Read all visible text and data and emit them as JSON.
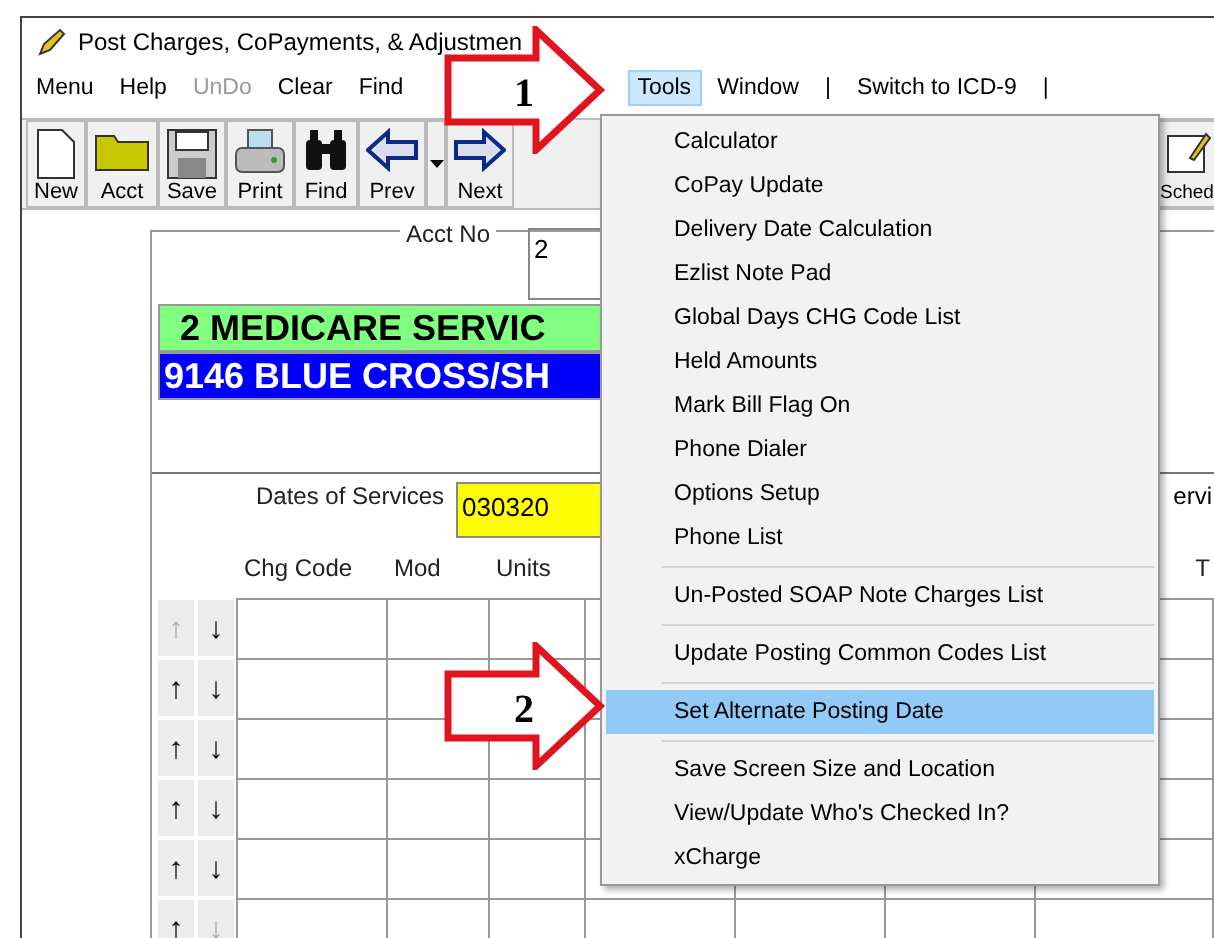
{
  "window": {
    "title": "Post Charges, CoPayments, & Adjustmen"
  },
  "menu_bar": [
    {
      "label": "Menu",
      "selected": false,
      "disabled": false
    },
    {
      "label": "Help",
      "selected": false,
      "disabled": false
    },
    {
      "label": "UnDo",
      "selected": false,
      "disabled": true
    },
    {
      "label": "Clear",
      "selected": false,
      "disabled": false
    },
    {
      "label": "Find",
      "selected": false,
      "disabled": false
    },
    {
      "label": "Tools",
      "selected": true,
      "disabled": false
    },
    {
      "label": "Window",
      "selected": false,
      "disabled": false
    },
    {
      "label": "|",
      "selected": false,
      "disabled": false
    },
    {
      "label": "Switch to ICD-9",
      "selected": false,
      "disabled": false
    },
    {
      "label": "|",
      "selected": false,
      "disabled": false
    }
  ],
  "toolbar": [
    {
      "label": "New",
      "kind": "new"
    },
    {
      "label": "Acct",
      "kind": "folder"
    },
    {
      "label": "Save",
      "kind": "save"
    },
    {
      "label": "Print",
      "kind": "print"
    },
    {
      "label": "Find",
      "kind": "find"
    },
    {
      "label": "Prev",
      "kind": "prev"
    },
    {
      "label": "Next",
      "kind": "next"
    }
  ],
  "toolbar_right": {
    "label": "Sched"
  },
  "form": {
    "acct_label": "Acct No",
    "acct_value": "2",
    "insurance": [
      {
        "text": "2 MEDICARE SERVIC",
        "color": "#80ff80"
      },
      {
        "text": "9146 BLUE CROSS/SH",
        "color": "#0000ff"
      }
    ],
    "dates_label": "Dates of Services",
    "dates_value": "030320",
    "right_label": "ervi",
    "columns": [
      "Chg Code",
      "Mod",
      "Units"
    ],
    "right_column": "T",
    "rows": [
      {
        "up": {
          "symbol": "↑",
          "disabled": true
        },
        "down": {
          "symbol": "↓",
          "disabled": false
        }
      },
      {
        "up": {
          "symbol": "↑",
          "disabled": false
        },
        "down": {
          "symbol": "↓",
          "disabled": false
        }
      },
      {
        "up": {
          "symbol": "↑",
          "disabled": false
        },
        "down": {
          "symbol": "↓",
          "disabled": false
        }
      },
      {
        "up": {
          "symbol": "↑",
          "disabled": false
        },
        "down": {
          "symbol": "↓",
          "disabled": false
        }
      },
      {
        "up": {
          "symbol": "↑",
          "disabled": false
        },
        "down": {
          "symbol": "↓",
          "disabled": false
        }
      },
      {
        "up": {
          "symbol": "↑",
          "disabled": false
        },
        "down": {
          "symbol": "↓",
          "disabled": true
        }
      }
    ]
  },
  "tools_menu": {
    "groups": [
      [
        {
          "label": "Calculator",
          "selected": false
        },
        {
          "label": "CoPay Update",
          "selected": false
        },
        {
          "label": "Delivery Date Calculation",
          "selected": false
        },
        {
          "label": "Ezlist Note Pad",
          "selected": false
        },
        {
          "label": "Global Days CHG Code List",
          "selected": false
        },
        {
          "label": "Held Amounts",
          "selected": false
        },
        {
          "label": "Mark Bill Flag On",
          "selected": false
        },
        {
          "label": "Phone Dialer",
          "selected": false
        },
        {
          "label": "Options Setup",
          "selected": false
        },
        {
          "label": "Phone List",
          "selected": false
        }
      ],
      [
        {
          "label": "Un-Posted SOAP Note Charges List",
          "selected": false
        }
      ],
      [
        {
          "label": "Update Posting Common Codes List",
          "selected": false
        }
      ],
      [
        {
          "label": "Set Alternate Posting Date",
          "selected": true
        }
      ],
      [
        {
          "label": "Save Screen Size and Location",
          "selected": false
        },
        {
          "label": "View/Update Who's Checked In?",
          "selected": false
        },
        {
          "label": "xCharge",
          "selected": false
        }
      ]
    ]
  },
  "annotations": [
    {
      "label": "1"
    },
    {
      "label": "2"
    }
  ]
}
